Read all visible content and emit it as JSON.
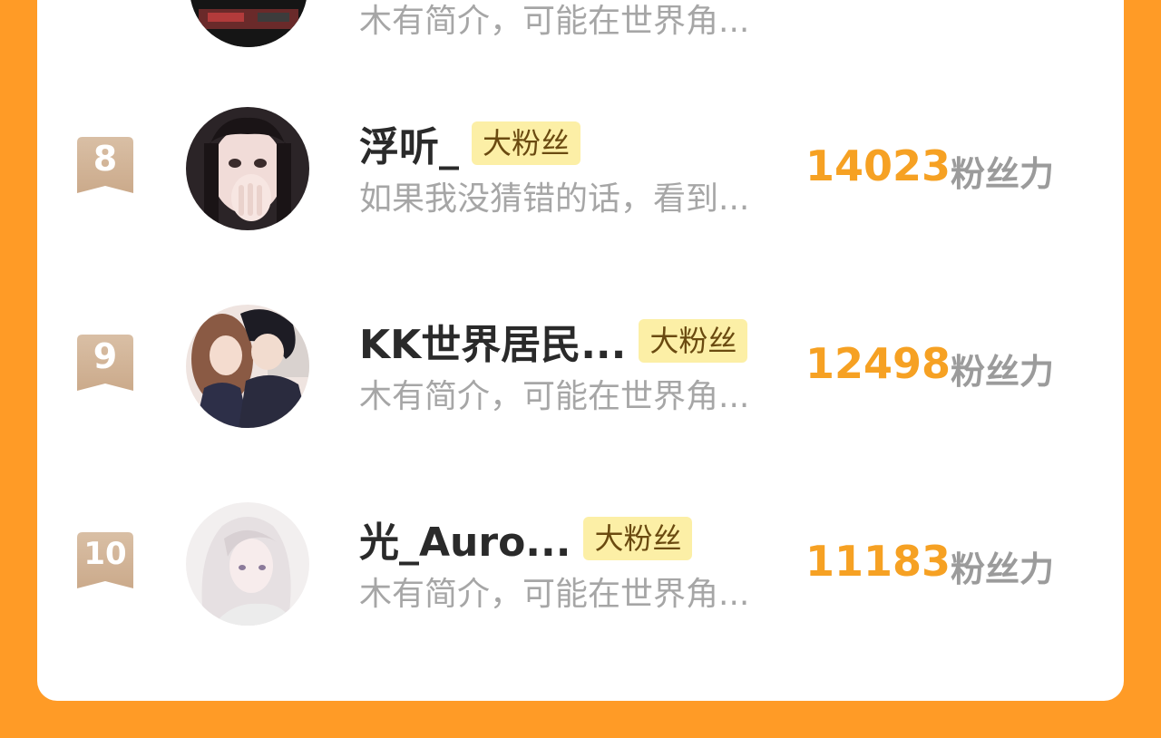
{
  "colors": {
    "background": "#FF9B26",
    "card": "#FFFFFF",
    "score": "#F6A123",
    "tag_bg": "#FCEFA6",
    "rank_badge": "#D2B49A"
  },
  "partial_top": {
    "desc": "木有简介，可能在世界角..."
  },
  "entries": [
    {
      "rank": "8",
      "name": "浮听_",
      "tag": "大粉丝",
      "desc": "如果我没猜错的话，看到...",
      "score": "14023",
      "score_label": "粉丝力",
      "avatar_icon": "avatar-girl-dark-hair"
    },
    {
      "rank": "9",
      "name": "KK世界居民...",
      "tag": "大粉丝",
      "desc": "木有简介，可能在世界角...",
      "score": "12498",
      "score_label": "粉丝力",
      "avatar_icon": "avatar-couple"
    },
    {
      "rank": "10",
      "name": "光_Auro...",
      "tag": "大粉丝",
      "desc": "木有简介，可能在世界角...",
      "score": "11183",
      "score_label": "粉丝力",
      "avatar_icon": "avatar-white-hair-girl"
    }
  ]
}
